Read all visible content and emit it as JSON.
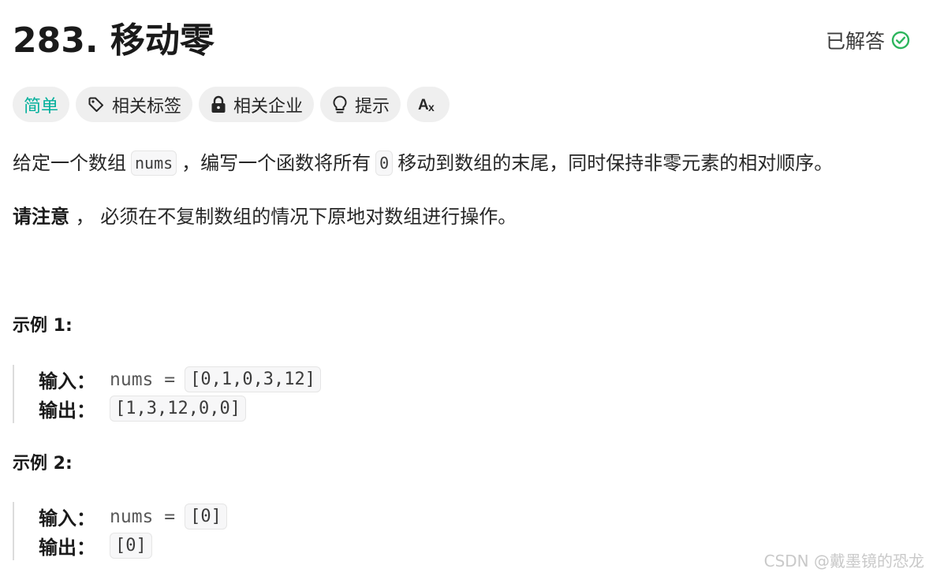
{
  "problem": {
    "title": "283. 移动零",
    "status": "已解答"
  },
  "tags": [
    {
      "label": "简单",
      "icon": ""
    },
    {
      "label": "相关标签",
      "icon": "tag-icon"
    },
    {
      "label": "相关企业",
      "icon": "lock-icon"
    },
    {
      "label": "提示",
      "icon": "lightbulb-icon"
    },
    {
      "label": "",
      "icon": "translate-icon"
    }
  ],
  "description": {
    "part1": "给定一个数组",
    "code1": "nums",
    "part2": "，编写一个函数将所有",
    "code2": "0",
    "part3": "移动到数组的末尾，同时保持非零元素的相对顺序。",
    "note_bold": "请注意",
    "note_rest": " ， 必须在不复制数组的情况下原地对数组进行操作。"
  },
  "examples": [
    {
      "title": "示例 1:",
      "input_label": "输入：",
      "input_text": "nums =",
      "input_code": "[0,1,0,3,12]",
      "output_label": "输出：",
      "output_code": "[1,3,12,0,0]"
    },
    {
      "title": "示例 2:",
      "input_label": "输入：",
      "input_text": "nums =",
      "input_code": "[0]",
      "output_label": "输出：",
      "output_code": "[0]"
    }
  ],
  "watermark": "CSDN @戴墨镜的恐龙",
  "colors": {
    "easy": "#00af9b",
    "solved_check": "#2db55d",
    "tag_bg": "#efefef"
  }
}
